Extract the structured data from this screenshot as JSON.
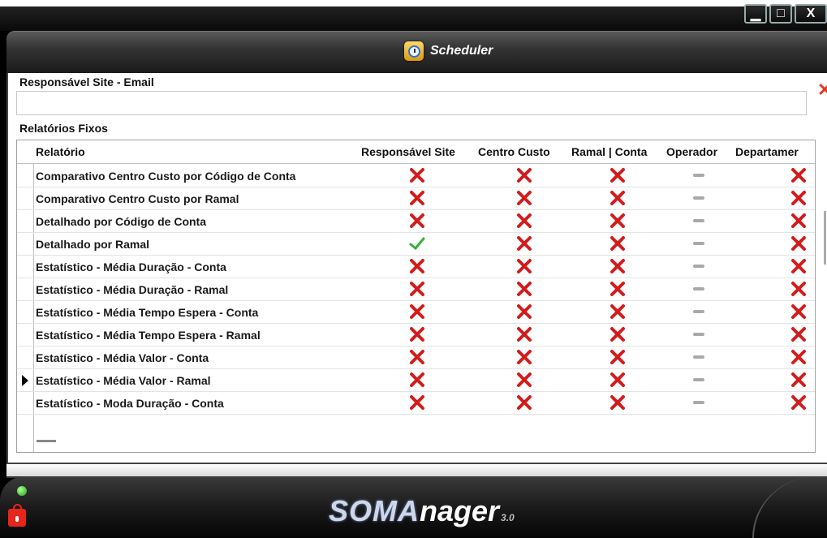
{
  "window": {
    "title": "Scheduler",
    "buttons": {
      "minimize": "▁",
      "maximize": "□",
      "close": "X"
    }
  },
  "email_section": {
    "label": "Responsável Site - Email",
    "input_value": "",
    "clear_icon": "✕"
  },
  "grid": {
    "section_label": "Relatórios Fixos",
    "columns": [
      "Relatório",
      "Responsável Site",
      "Centro Custo",
      "Ramal | Conta",
      "Operador",
      "Departamer"
    ],
    "rows": [
      {
        "name": "Comparativo Centro Custo por Código de Conta",
        "values": [
          "x",
          "x",
          "x",
          "-",
          "x"
        ]
      },
      {
        "name": "Comparativo Centro Custo por Ramal",
        "values": [
          "x",
          "x",
          "x",
          "-",
          "x"
        ]
      },
      {
        "name": "Detalhado por Código de Conta",
        "values": [
          "x",
          "x",
          "x",
          "-",
          "x"
        ]
      },
      {
        "name": "Detalhado por Ramal",
        "values": [
          "check",
          "x",
          "x",
          "-",
          "x"
        ]
      },
      {
        "name": "Estatístico - Média Duração - Conta",
        "values": [
          "x",
          "x",
          "x",
          "-",
          "x"
        ]
      },
      {
        "name": "Estatístico - Média Duração - Ramal",
        "values": [
          "x",
          "x",
          "x",
          "-",
          "x"
        ]
      },
      {
        "name": "Estatístico - Média Tempo Espera - Conta",
        "values": [
          "x",
          "x",
          "x",
          "-",
          "x"
        ]
      },
      {
        "name": "Estatístico - Média Tempo Espera - Ramal",
        "values": [
          "x",
          "x",
          "x",
          "-",
          "x"
        ]
      },
      {
        "name": "Estatístico - Média Valor - Conta",
        "values": [
          "x",
          "x",
          "x",
          "-",
          "x"
        ]
      },
      {
        "name": "Estatístico - Média Valor - Ramal",
        "values": [
          "x",
          "x",
          "x",
          "-",
          "x"
        ],
        "current": true
      },
      {
        "name": "Estatístico - Moda Duração - Conta",
        "values": [
          "x",
          "x",
          "x",
          "-",
          "x"
        ]
      }
    ]
  },
  "footer": {
    "logo_soma": "SOMA",
    "logo_manager": "nager",
    "logo_version": "3.0",
    "status_led_color": "#21a11b",
    "lock_color": "#e8251a"
  },
  "colors": {
    "x": "#d21c1c",
    "check": "#39b03a",
    "dash": "#a9a9a9"
  }
}
